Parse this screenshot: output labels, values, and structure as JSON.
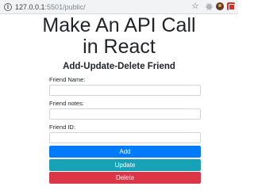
{
  "browser": {
    "url_host": "127.0.0.1",
    "url_rest": ":5501/public/",
    "info_glyph": "i",
    "star_glyph": "☆",
    "extensions": [
      "react-devtools-icon",
      "cookie-icon",
      "screenshot-extension-icon"
    ]
  },
  "page": {
    "title_line1": "Make An API Call",
    "title_line2": "in React",
    "subtitle": "Add-Update-Delete Friend"
  },
  "form": {
    "friend_name_label": "Friend Name:",
    "friend_name_value": "",
    "friend_notes_label": "Friend notes:",
    "friend_notes_value": "",
    "friend_id_label": "Friend ID:",
    "friend_id_value": ""
  },
  "buttons": {
    "add_label": "Add",
    "update_label": "Update",
    "delete_label": "Delete"
  },
  "colors": {
    "add": "#007bff",
    "update": "#17a2b8",
    "delete": "#dc3545"
  }
}
